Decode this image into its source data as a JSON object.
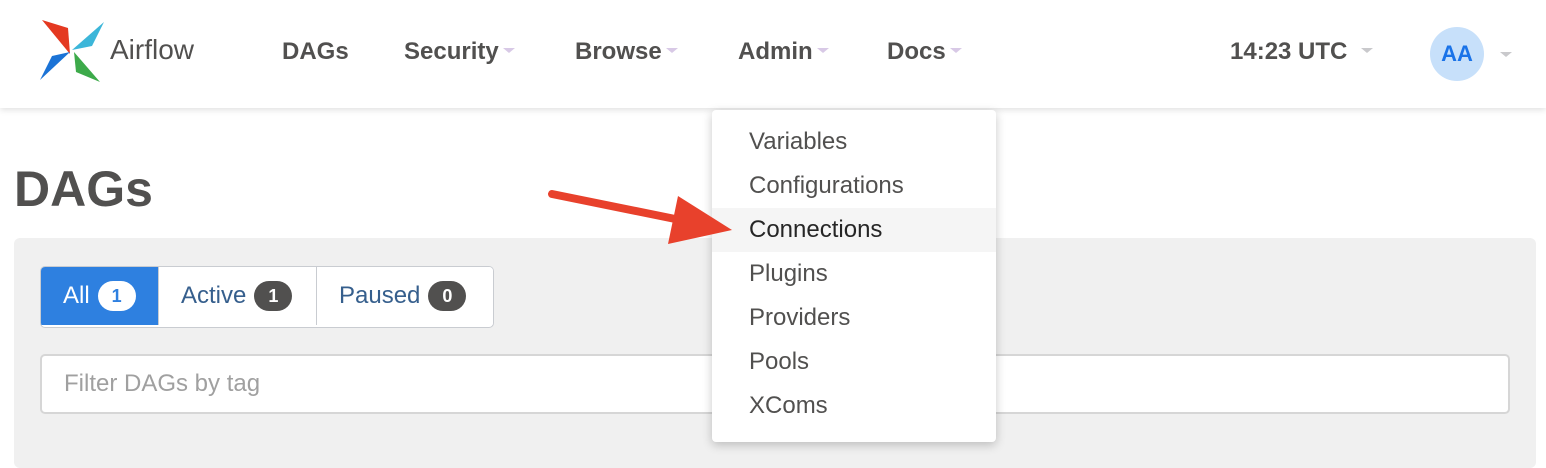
{
  "app": {
    "name": "Airflow"
  },
  "nav": {
    "items": [
      {
        "label": "DAGs"
      },
      {
        "label": "Security"
      },
      {
        "label": "Browse"
      },
      {
        "label": "Admin"
      },
      {
        "label": "Docs"
      }
    ],
    "time": "14:23 UTC",
    "user_initials": "AA"
  },
  "admin_menu": {
    "items": [
      {
        "label": "Variables"
      },
      {
        "label": "Configurations"
      },
      {
        "label": "Connections",
        "highlighted": true
      },
      {
        "label": "Plugins"
      },
      {
        "label": "Providers"
      },
      {
        "label": "Pools"
      },
      {
        "label": "XComs"
      }
    ]
  },
  "page": {
    "title": "DAGs",
    "filters": [
      {
        "label": "All",
        "count": "1",
        "active": true
      },
      {
        "label": "Active",
        "count": "1"
      },
      {
        "label": "Paused",
        "count": "0"
      }
    ],
    "tag_filter_placeholder": "Filter DAGs by tag"
  },
  "colors": {
    "accent": "#2e80e0",
    "annotation_arrow": "#e8412c"
  },
  "icons": [
    "airflow-logo",
    "caret-down-icon",
    "arrow-annotation"
  ]
}
